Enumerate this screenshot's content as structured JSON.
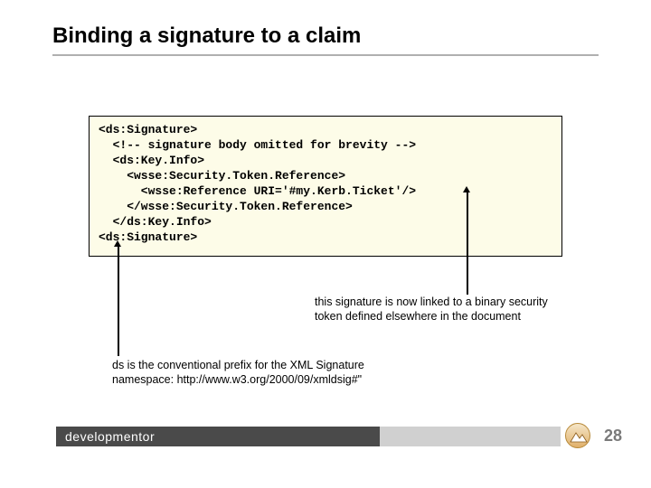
{
  "title": "Binding a signature to a claim",
  "code_lines": [
    "<ds:Signature>",
    "  <!-- signature body omitted for brevity -->",
    "  <ds:Key.Info>",
    "    <wsse:Security.Token.Reference>",
    "      <wsse:Reference URI='#my.Kerb.Ticket'/>",
    "    </wsse:Security.Token.Reference>",
    "  </ds:Key.Info>",
    "<ds:Signature>"
  ],
  "annotation_right": "this signature is now linked to a binary security token defined elsewhere in the document",
  "annotation_left": "ds is the conventional prefix for the XML Signature namespace: http://www.w3.org/2000/09/xmldsig#\"",
  "footer_brand": "developmentor",
  "page_number": "28"
}
